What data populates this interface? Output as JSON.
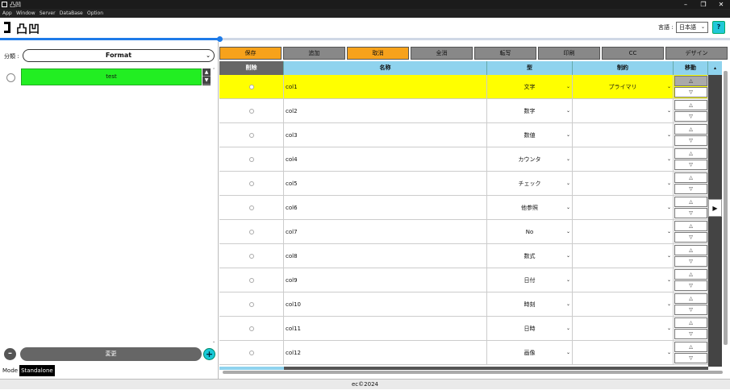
{
  "window": {
    "title": "凸凹",
    "controls": [
      "–",
      "❐",
      "✕"
    ]
  },
  "menu": [
    "App",
    "Window",
    "Server",
    "DataBase",
    "Option"
  ],
  "header": {
    "logo_text": "凸凹",
    "language_label": "言語 :",
    "language_value": "日本語",
    "help_label": "?"
  },
  "progress": {
    "fraction": 0.3
  },
  "left": {
    "category_label": "分類 :",
    "category_value": "Format",
    "items": [
      {
        "label": "test"
      }
    ],
    "change_label": "変更",
    "minus_label": "–",
    "plus_label": "+",
    "mode_label": "Mode",
    "mode_value": "Standalone"
  },
  "toolbar": {
    "buttons": [
      "保存",
      "追加",
      "取消",
      "全消",
      "転写",
      "印刷",
      "CC",
      "デザイン"
    ]
  },
  "grid": {
    "columns": [
      "削除",
      "名称",
      "型",
      "制約",
      "移動"
    ],
    "rows": [
      {
        "name": "col1",
        "type": "文字",
        "constraint": "プライマリ"
      },
      {
        "name": "col2",
        "type": "数字",
        "constraint": ""
      },
      {
        "name": "col3",
        "type": "数値",
        "constraint": ""
      },
      {
        "name": "col4",
        "type": "カウンタ",
        "constraint": ""
      },
      {
        "name": "col5",
        "type": "チェック",
        "constraint": ""
      },
      {
        "name": "col6",
        "type": "他参照",
        "constraint": ""
      },
      {
        "name": "col7",
        "type": "No",
        "constraint": ""
      },
      {
        "name": "col8",
        "type": "数式",
        "constraint": ""
      },
      {
        "name": "col9",
        "type": "日付",
        "constraint": ""
      },
      {
        "name": "col10",
        "type": "時刻",
        "constraint": ""
      },
      {
        "name": "col11",
        "type": "日時",
        "constraint": ""
      },
      {
        "name": "col12",
        "type": "画像",
        "constraint": ""
      }
    ],
    "move_up": "△",
    "move_down": "▽"
  },
  "status": {
    "text": "ec©2024"
  }
}
